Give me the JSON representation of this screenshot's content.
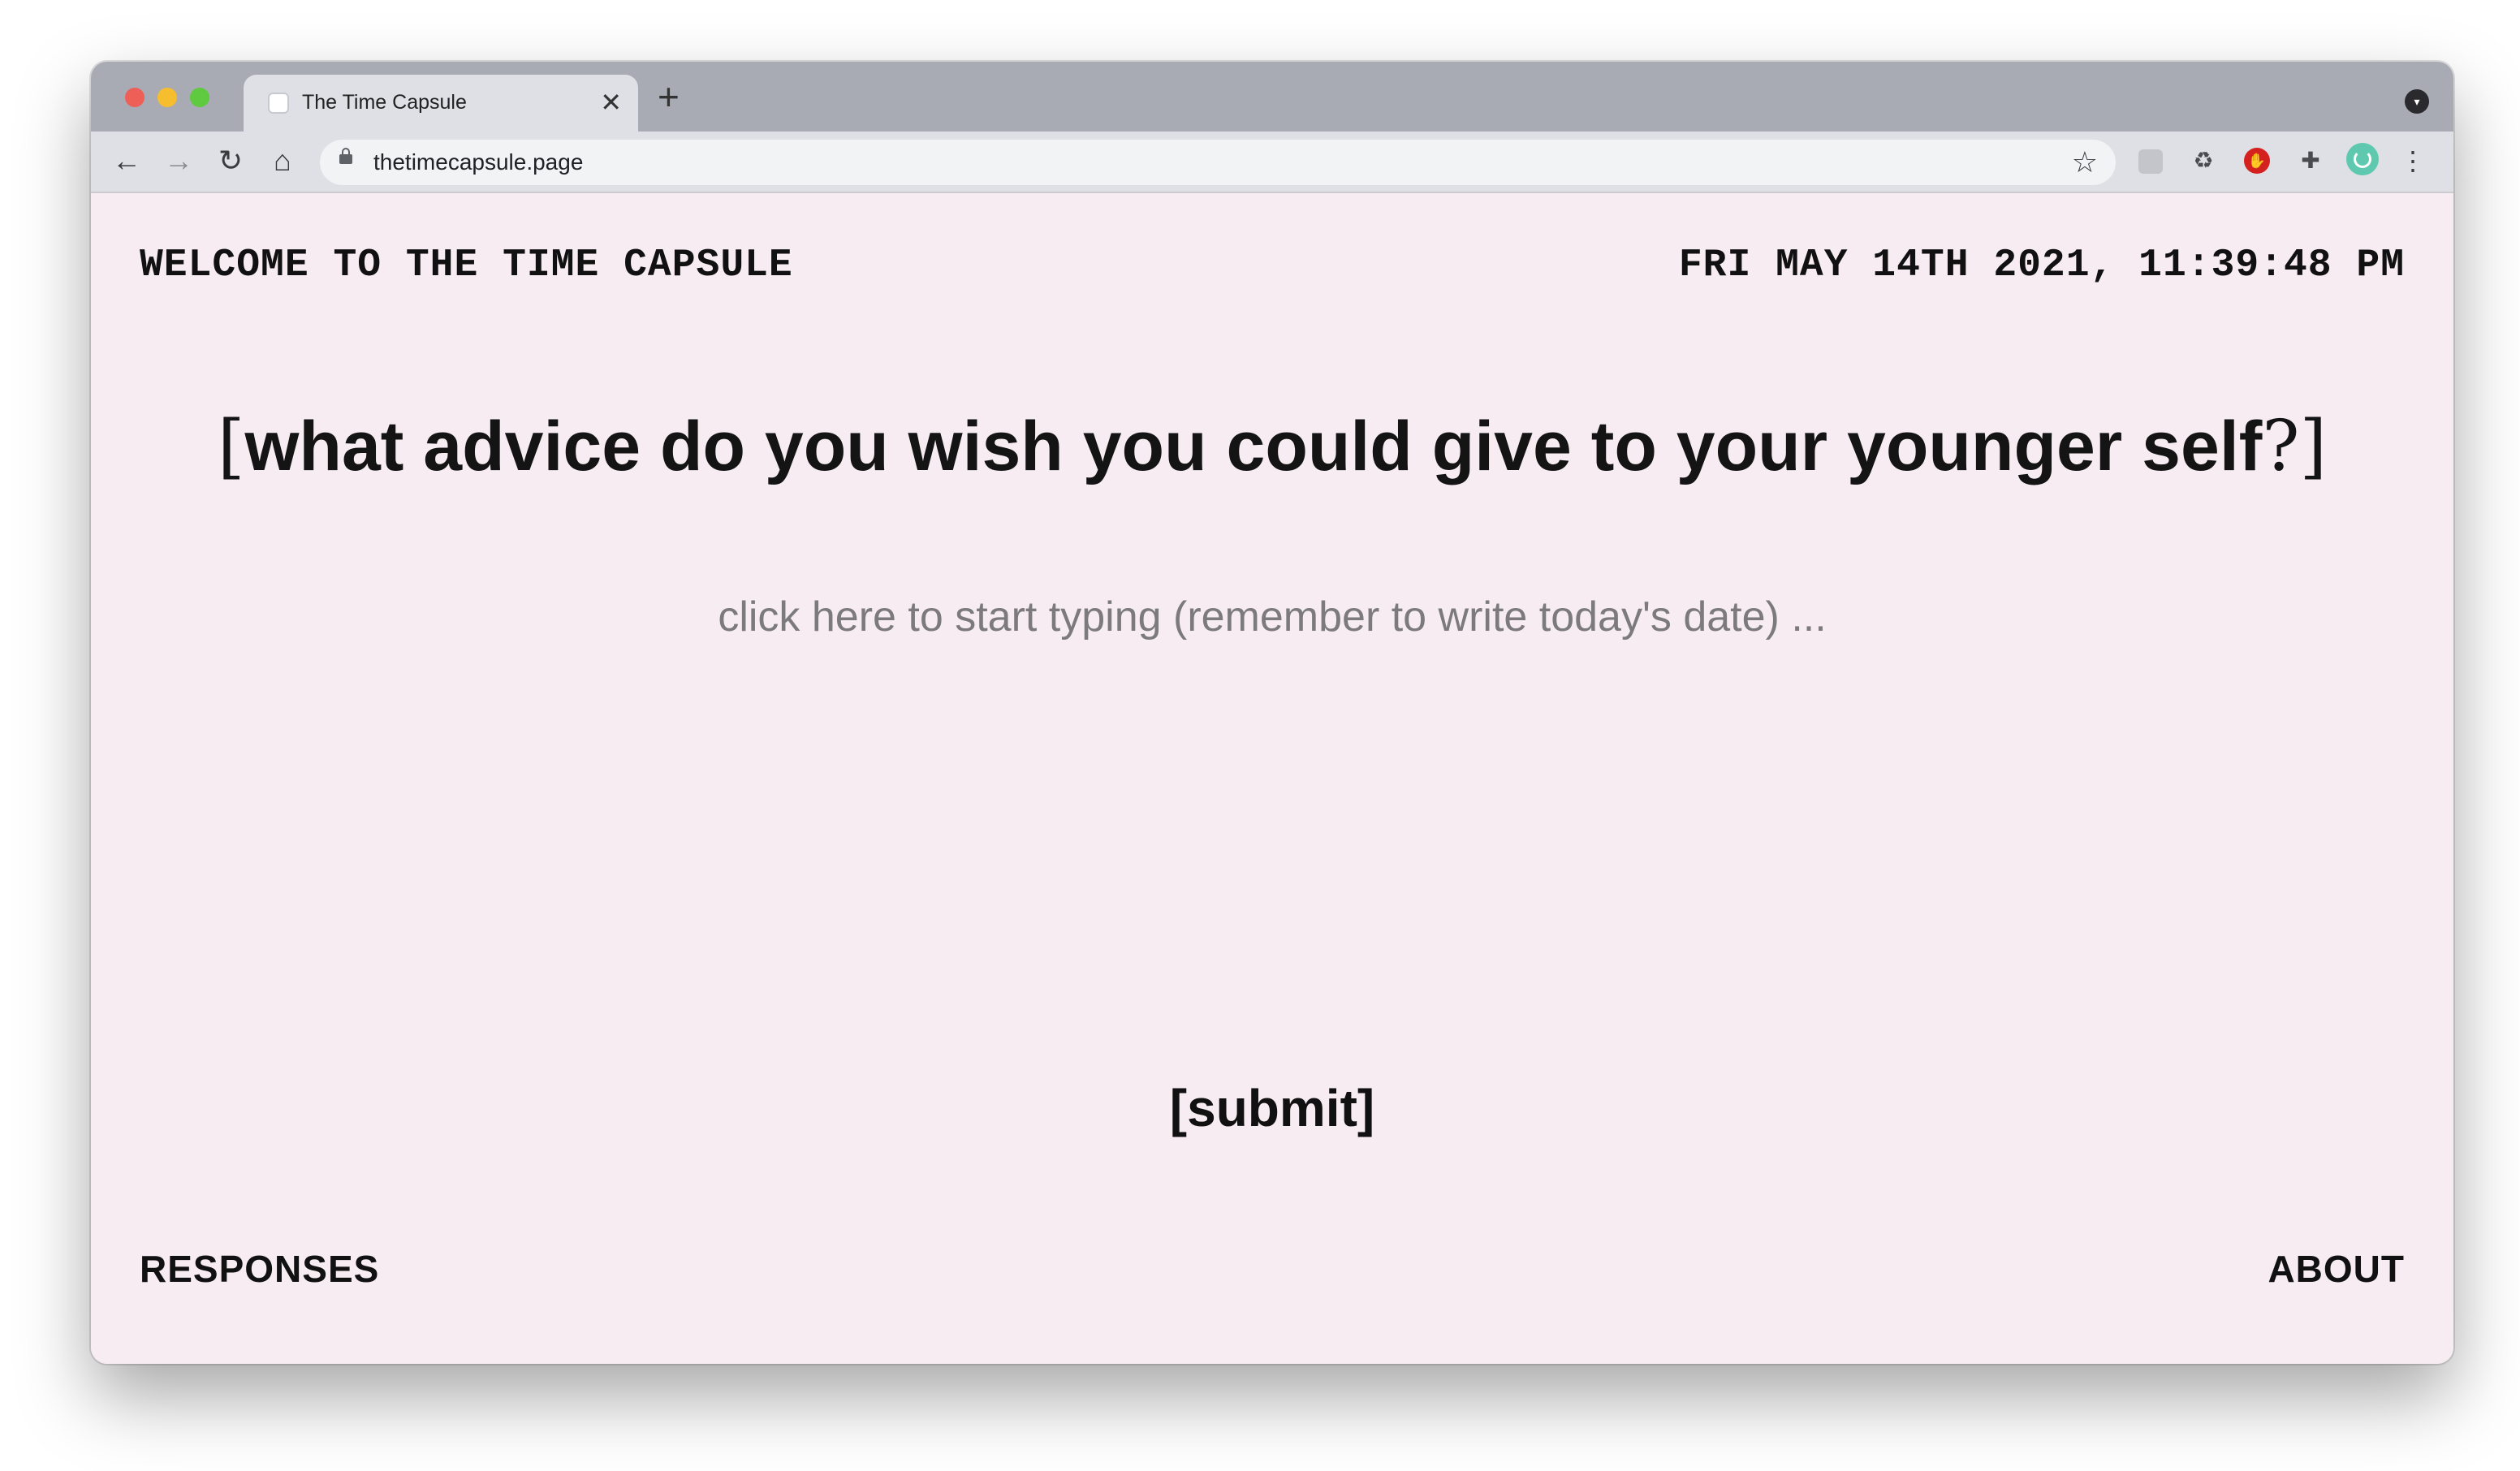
{
  "browser": {
    "tab_title": "The Time Capsule",
    "tab_close": "✕",
    "new_tab": "+",
    "url": "thetimecapsule.page",
    "icons": [
      "back-icon",
      "forward-icon",
      "reload-icon",
      "home-icon",
      "lock-icon",
      "star-icon",
      "extension-icons",
      "menu-icon"
    ]
  },
  "header": {
    "welcome": "WELCOME TO THE TIME CAPSULE",
    "datetime": "FRI MAY 14TH 2021, 11:39:48 PM"
  },
  "prompt": {
    "open": "[",
    "question": "what advice do you wish you could give to your younger self",
    "qmark": "?]"
  },
  "answer": {
    "placeholder": "click here to start typing (remember to write today's date) ...",
    "value": ""
  },
  "submit_label": "[submit]",
  "footer": {
    "responses": "RESPONSES",
    "about": "ABOUT"
  },
  "colors": {
    "page_background": "#f6ecf1",
    "text": "#111111",
    "placeholder": "#7c7a7c",
    "tabstrip": "#a8aab4"
  }
}
